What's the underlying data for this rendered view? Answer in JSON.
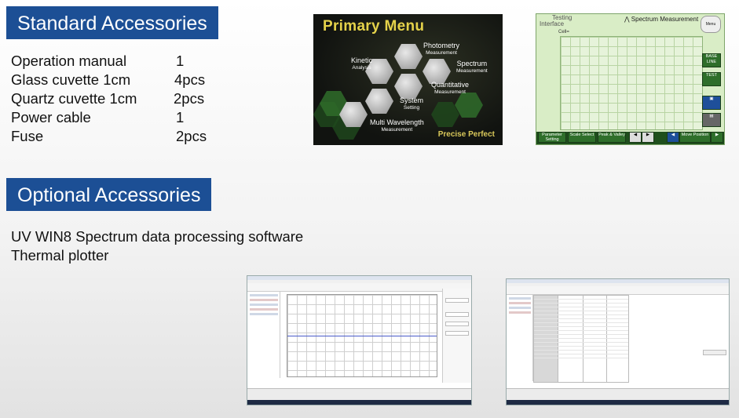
{
  "standard": {
    "header": "Standard Accessories",
    "items": [
      {
        "name": "Operation manual",
        "qty": "1"
      },
      {
        "name": "Glass cuvette 1cm",
        "qty": "4pcs"
      },
      {
        "name": "Quartz cuvette 1cm",
        "qty": "2pcs"
      },
      {
        "name": "Power cable",
        "qty": "1"
      },
      {
        "name": "Fuse",
        "qty": "2pcs"
      }
    ]
  },
  "optional": {
    "header": "Optional Accessories",
    "items": [
      "UV WIN8 Spectrum data processing software",
      "Thermal plotter"
    ]
  },
  "primary_menu": {
    "title": "Primary Menu",
    "options": [
      {
        "main": "Photometry",
        "sub": "Measurement"
      },
      {
        "main": "Kinetic",
        "sub": "Analysis"
      },
      {
        "main": "Spectrum",
        "sub": "Measurement"
      },
      {
        "main": "Quantitative",
        "sub": "Measurement"
      },
      {
        "main": "System",
        "sub": "Setting"
      },
      {
        "main": "Multi Wavelength",
        "sub": "Measurement"
      }
    ],
    "slogan": "Precise Perfect"
  },
  "spectrum_screen": {
    "interface_label_1": "Testing",
    "interface_label_2": "Interface",
    "cell_label": "Cell=",
    "title": "Spectrum Measurement",
    "menu_button": "Menu",
    "side_buttons": [
      "BASE LINE",
      "TEST"
    ],
    "bottom_buttons": [
      "Parameter Setting",
      "Scale Select",
      "Peak & Valley",
      "Move Position"
    ]
  },
  "colors": {
    "header_bg": "#1c4f95",
    "menu_title": "#e5d24a",
    "screen_green": "#2e6e2a"
  }
}
